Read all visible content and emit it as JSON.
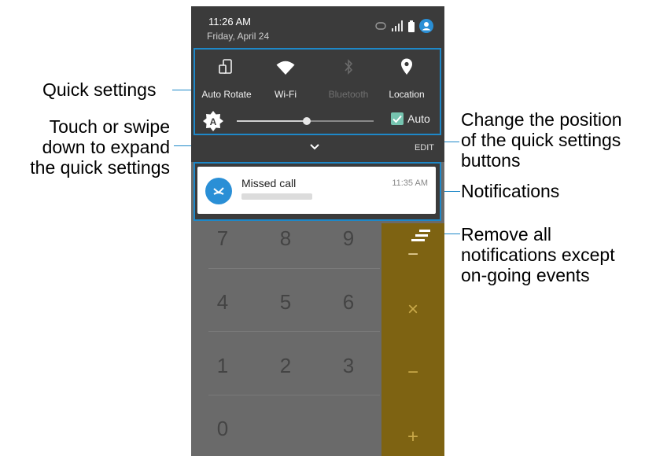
{
  "status_bar": {
    "time": "11:26 AM",
    "date": "Friday, April 24"
  },
  "quick_settings": {
    "tiles": [
      {
        "label": "Auto Rotate",
        "icon": "auto-rotate-icon",
        "enabled": true
      },
      {
        "label": "Wi-Fi",
        "icon": "wifi-icon",
        "enabled": true
      },
      {
        "label": "Bluetooth",
        "icon": "bluetooth-icon",
        "enabled": false
      },
      {
        "label": "Location",
        "icon": "location-icon",
        "enabled": true
      }
    ],
    "brightness": {
      "level": 0.51,
      "auto_label": "Auto",
      "auto_checked": true
    },
    "edit_label": "EDIT"
  },
  "notification": {
    "title": "Missed call",
    "time": "11:35 AM"
  },
  "dialpad": {
    "keys": [
      "7",
      "8",
      "9",
      "4",
      "5",
      "6",
      "1",
      "2",
      "3",
      "0"
    ],
    "operators": [
      "−",
      "×",
      "−",
      "+"
    ]
  },
  "callouts": {
    "quick_settings": "Quick settings",
    "expand": [
      "Touch or swipe",
      "down to expand",
      "the quick settings"
    ],
    "change_position": [
      "Change the position",
      "of the quick settings",
      "buttons"
    ],
    "notifications": "Notifications",
    "remove_all": [
      "Remove all",
      "notifications except",
      "on-going events"
    ]
  },
  "colors": {
    "panel": "#3b3b3b",
    "accent_frame": "#1e88c8",
    "avatar": "#2a8fd6",
    "operator_column": "#7e6312"
  }
}
